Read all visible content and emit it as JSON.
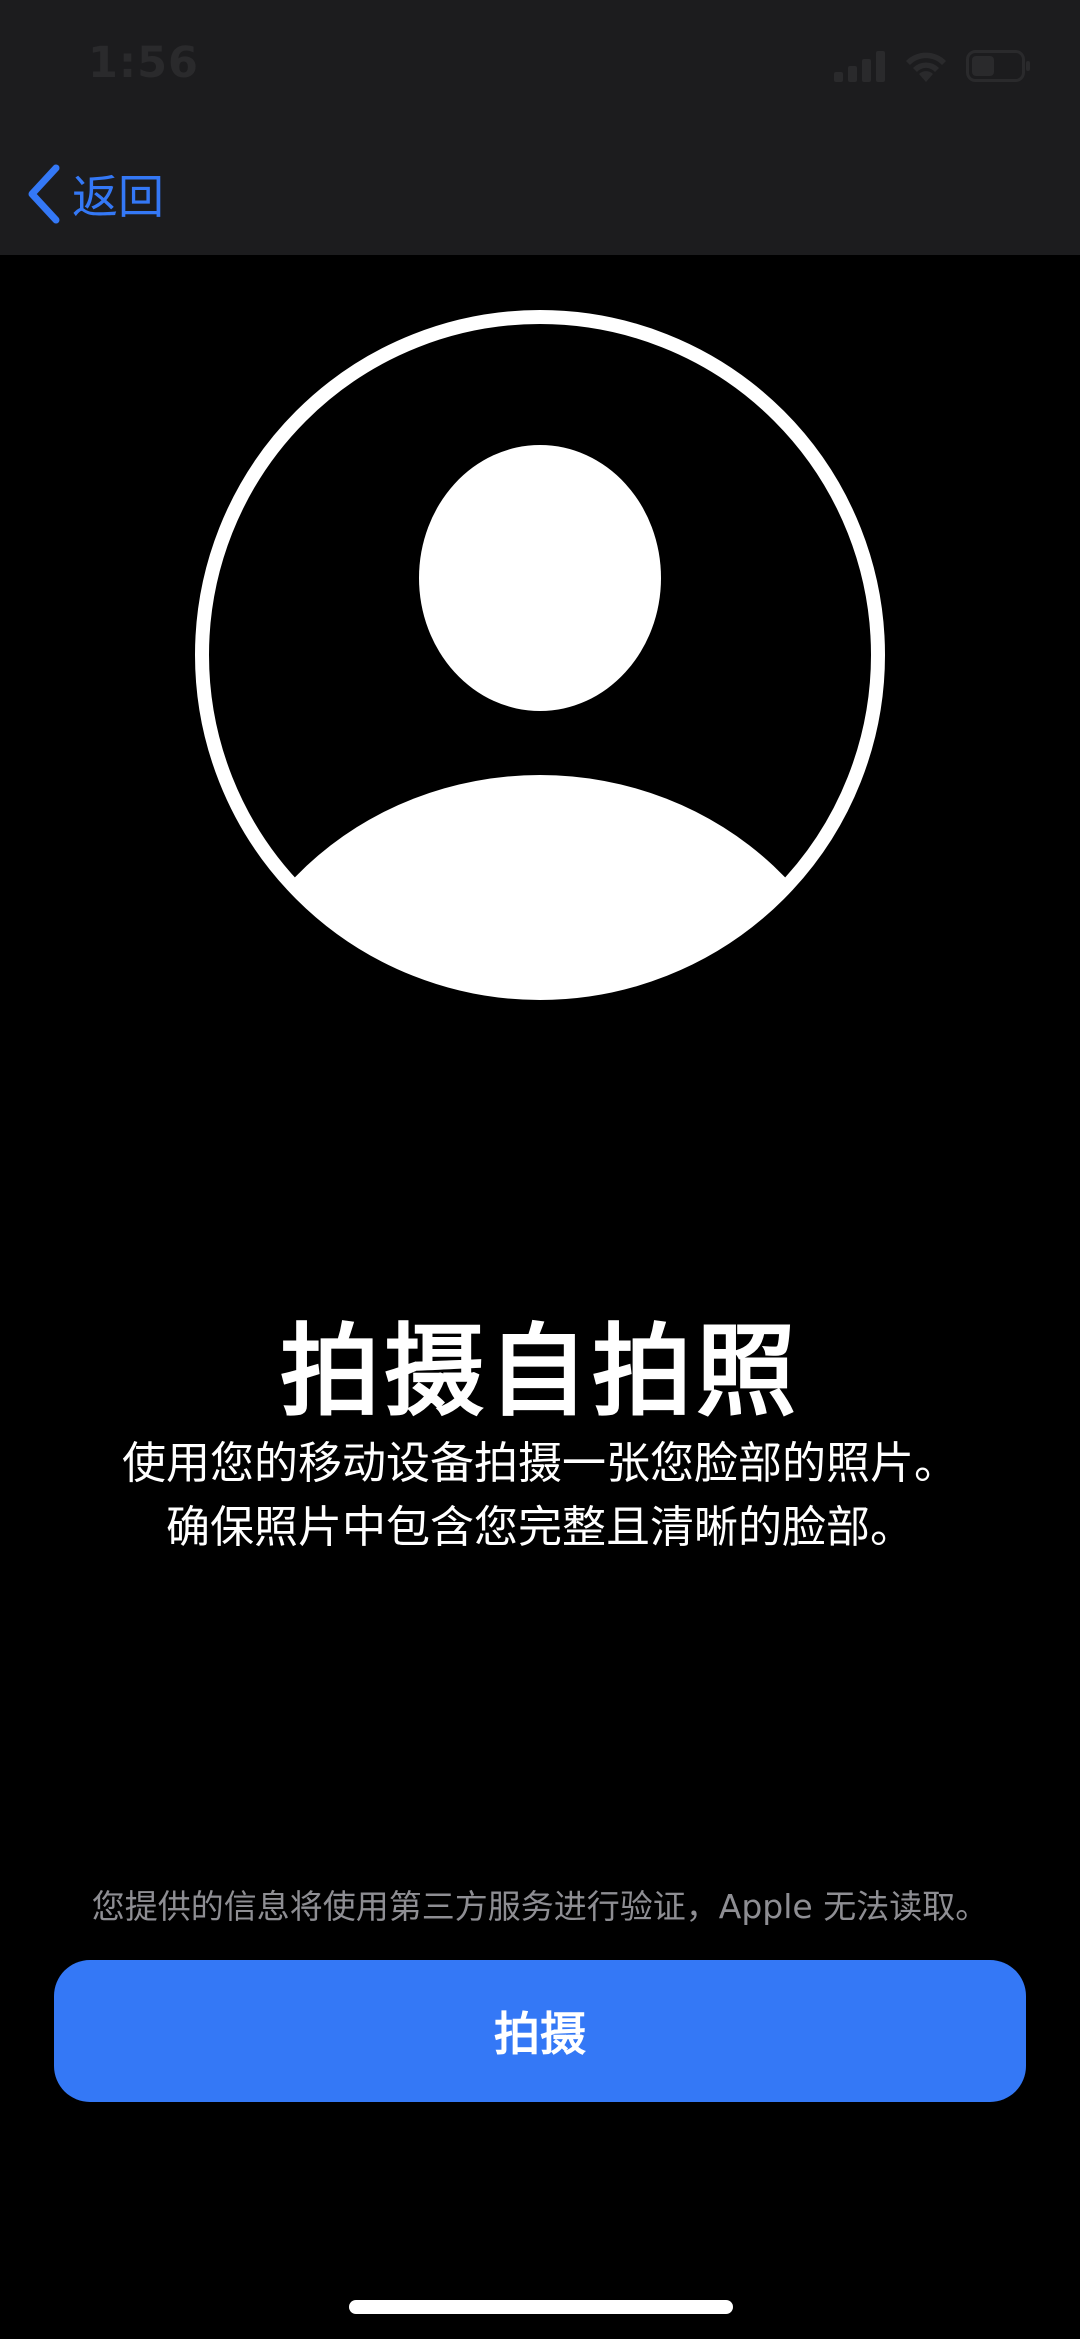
{
  "status_bar": {
    "time": "1:56",
    "icons": [
      "signal-icon",
      "wifi-icon",
      "battery-icon"
    ]
  },
  "nav": {
    "back_icon": "chevron-left-icon",
    "back_label": "返回"
  },
  "avatar": {
    "icon": "person-silhouette-icon"
  },
  "main": {
    "title": "拍摄自拍照",
    "description_lines": [
      "使用您的移动设备拍摄一张您脸部的照片。",
      "确保照片中包含您完整且清晰的脸部。"
    ],
    "disclaimer": "您提供的信息将使用第三方服务进行验证，Apple 无法读取。"
  },
  "actions": {
    "capture_label": "拍摄"
  },
  "colors": {
    "accent": "#3478f6",
    "background": "#000000",
    "top_bar": "#1c1c1e",
    "secondary_text": "#8e8e93"
  }
}
